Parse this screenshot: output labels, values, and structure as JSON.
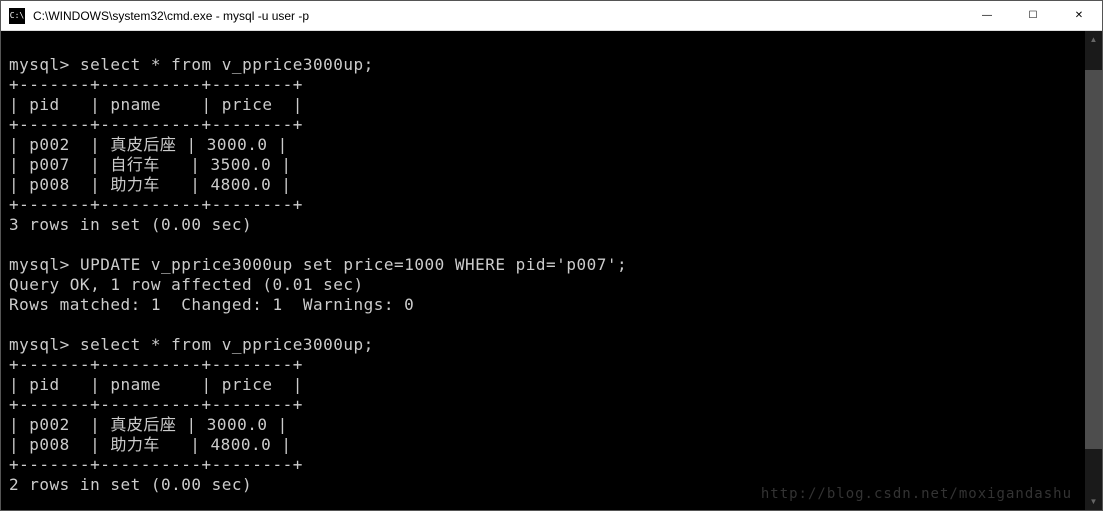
{
  "window": {
    "icon_label": "C:\\",
    "title": "C:\\WINDOWS\\system32\\cmd.exe - mysql  -u user -p"
  },
  "controls": {
    "minimize": "—",
    "maximize": "☐",
    "close": "✕"
  },
  "terminal": {
    "prompt": "mysql>",
    "query1": "select * from v_pprice3000up;",
    "headers": {
      "pid": "pid",
      "pname": "pname",
      "price": "price"
    },
    "table1": {
      "border_top": "+-------+----------+--------+",
      "header_row": "| pid   | pname    | price  |",
      "border_mid": "+-------+----------+--------+",
      "row1": "| p002  | 真皮后座 | 3000.0 |",
      "row2": "| p007  | 自行车   | 3500.0 |",
      "row3": "| p008  | 助力车   | 4800.0 |",
      "border_bot": "+-------+----------+--------+",
      "summary": "3 rows in set (0.00 sec)"
    },
    "query2": "UPDATE v_pprice3000up set price=1000 WHERE pid='p007';",
    "result2_line1": "Query OK, 1 row affected (0.01 sec)",
    "result2_line2": "Rows matched: 1  Changed: 1  Warnings: 0",
    "query3": "select * from v_pprice3000up;",
    "table2": {
      "border_top": "+-------+----------+--------+",
      "header_row": "| pid   | pname    | price  |",
      "border_mid": "+-------+----------+--------+",
      "row1": "| p002  | 真皮后座 | 3000.0 |",
      "row2": "| p008  | 助力车   | 4800.0 |",
      "border_bot": "+-------+----------+--------+",
      "summary": "2 rows in set (0.00 sec)"
    }
  },
  "watermark": "http://blog.csdn.net/moxigandashu"
}
